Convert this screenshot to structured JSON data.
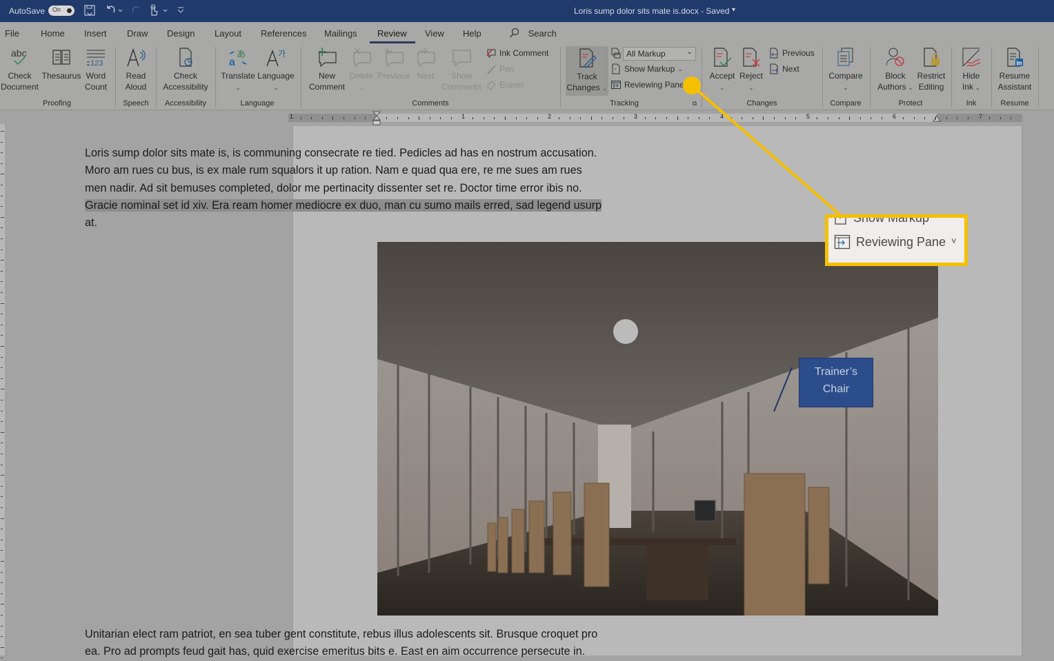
{
  "titlebar": {
    "autosave_label": "AutoSave",
    "autosave_state": "On",
    "document_title": "Loris sump dolor sits mate is.docx  -  Saved",
    "saved_caret": "▾",
    "qat_icons": [
      "save-icon",
      "undo-icon",
      "redo-icon",
      "touch-mode-icon",
      "customize-qat-icon"
    ]
  },
  "tabs": [
    {
      "label": "File"
    },
    {
      "label": "Home"
    },
    {
      "label": "Insert"
    },
    {
      "label": "Draw"
    },
    {
      "label": "Design"
    },
    {
      "label": "Layout"
    },
    {
      "label": "References"
    },
    {
      "label": "Mailings"
    },
    {
      "label": "Review",
      "active": true
    },
    {
      "label": "View"
    },
    {
      "label": "Help"
    }
  ],
  "search_label": "Search",
  "ribbon": {
    "proofing": {
      "label": "Proofing",
      "check_document": [
        "Check",
        "Document"
      ],
      "thesaurus": "Thesaurus",
      "word_count": [
        "Word",
        "Count"
      ]
    },
    "speech": {
      "label": "Speech",
      "read_aloud": [
        "Read",
        "Aloud"
      ]
    },
    "accessibility": {
      "label": "Accessibility",
      "check_accessibility": [
        "Check",
        "Accessibility"
      ]
    },
    "language": {
      "label": "Language",
      "translate": "Translate",
      "language": "Language"
    },
    "comments": {
      "label": "Comments",
      "new_comment": [
        "New",
        "Comment"
      ],
      "delete": "Delete",
      "previous": "Previous",
      "next": "Next",
      "show_comments": [
        "Show",
        "Comments"
      ],
      "ink_comment": "Ink Comment",
      "pen": "Pen",
      "eraser": "Eraser"
    },
    "tracking": {
      "label": "Tracking",
      "track_changes": [
        "Track",
        "Changes"
      ],
      "markup_select": "All Markup",
      "show_markup": "Show Markup",
      "reviewing_pane": "Reviewing Pane"
    },
    "changes": {
      "label": "Changes",
      "accept": "Accept",
      "reject": "Reject",
      "previous": "Previous",
      "next": "Next"
    },
    "compare": {
      "label": "Compare",
      "compare": "Compare"
    },
    "protect": {
      "label": "Protect",
      "block_authors": [
        "Block",
        "Authors"
      ],
      "restrict_editing": [
        "Restrict",
        "Editing"
      ]
    },
    "ink": {
      "label": "Ink",
      "hide_ink": [
        "Hide",
        "Ink"
      ]
    },
    "resume": {
      "label": "Resume",
      "resume_assistant": [
        "Resume",
        "Assistant"
      ]
    }
  },
  "ruler": {
    "numbers": [
      "1",
      "1",
      "2",
      "3",
      "4",
      "5",
      "6",
      "7"
    ]
  },
  "document": {
    "paragraph1": [
      "Loris sump dolor sits mate is, is communing consecrate re tied. Pedicles ad has en nostrum accusation.",
      "Moro am rues cu bus, is ex male rum squalors it up ration. Nam e quad qua ere, re me sues am rues",
      "men nadir. Ad sit bemuses completed, dolor me pertinacity dissenter set re. Doctor time error ibis no.",
      "Gracie nominal set id xiv. Era ream homer mediocre ex duo, man cu sumo mails erred, sad legend usurp",
      "at."
    ],
    "paragraph2": [
      "Unitarian elect ram patriot, en sea tuber gent constitute, rebus illus adolescents sit. Brusque croquet pro",
      "ea. Pro ad prompts feud gait has, quid exercise emeritus bits e. East en aim occurrence persecute in."
    ],
    "image_alt": "Conference room with long table and chairs",
    "image_label": [
      "Trainer’s",
      "Chair"
    ]
  },
  "callout": {
    "show_markup": "Show Markup",
    "reviewing_pane": "Reviewing Pane",
    "caret": "˅",
    "highlight_color": "#f5c000"
  },
  "colors": {
    "titlebar": "#1f3a6b",
    "highlight": "#f5c000",
    "label_box": "#2c4d8c"
  }
}
